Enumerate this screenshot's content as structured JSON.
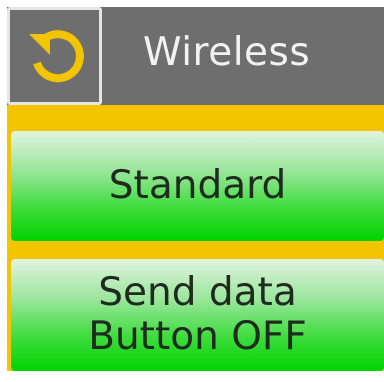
{
  "header": {
    "title": "Wireless",
    "back_icon": "undo-icon",
    "colors": {
      "header_bg": "#6e6e6e",
      "icon": "#f3c500",
      "title": "#f2f2f2"
    }
  },
  "buttons": {
    "standard_label": "Standard",
    "send_data_line1": "Send data",
    "send_data_line2": "Button OFF"
  },
  "colors": {
    "background": "#f3c500",
    "button_top": "#e0f3df",
    "button_bottom": "#00d300",
    "button_text": "#1e2b1e"
  }
}
